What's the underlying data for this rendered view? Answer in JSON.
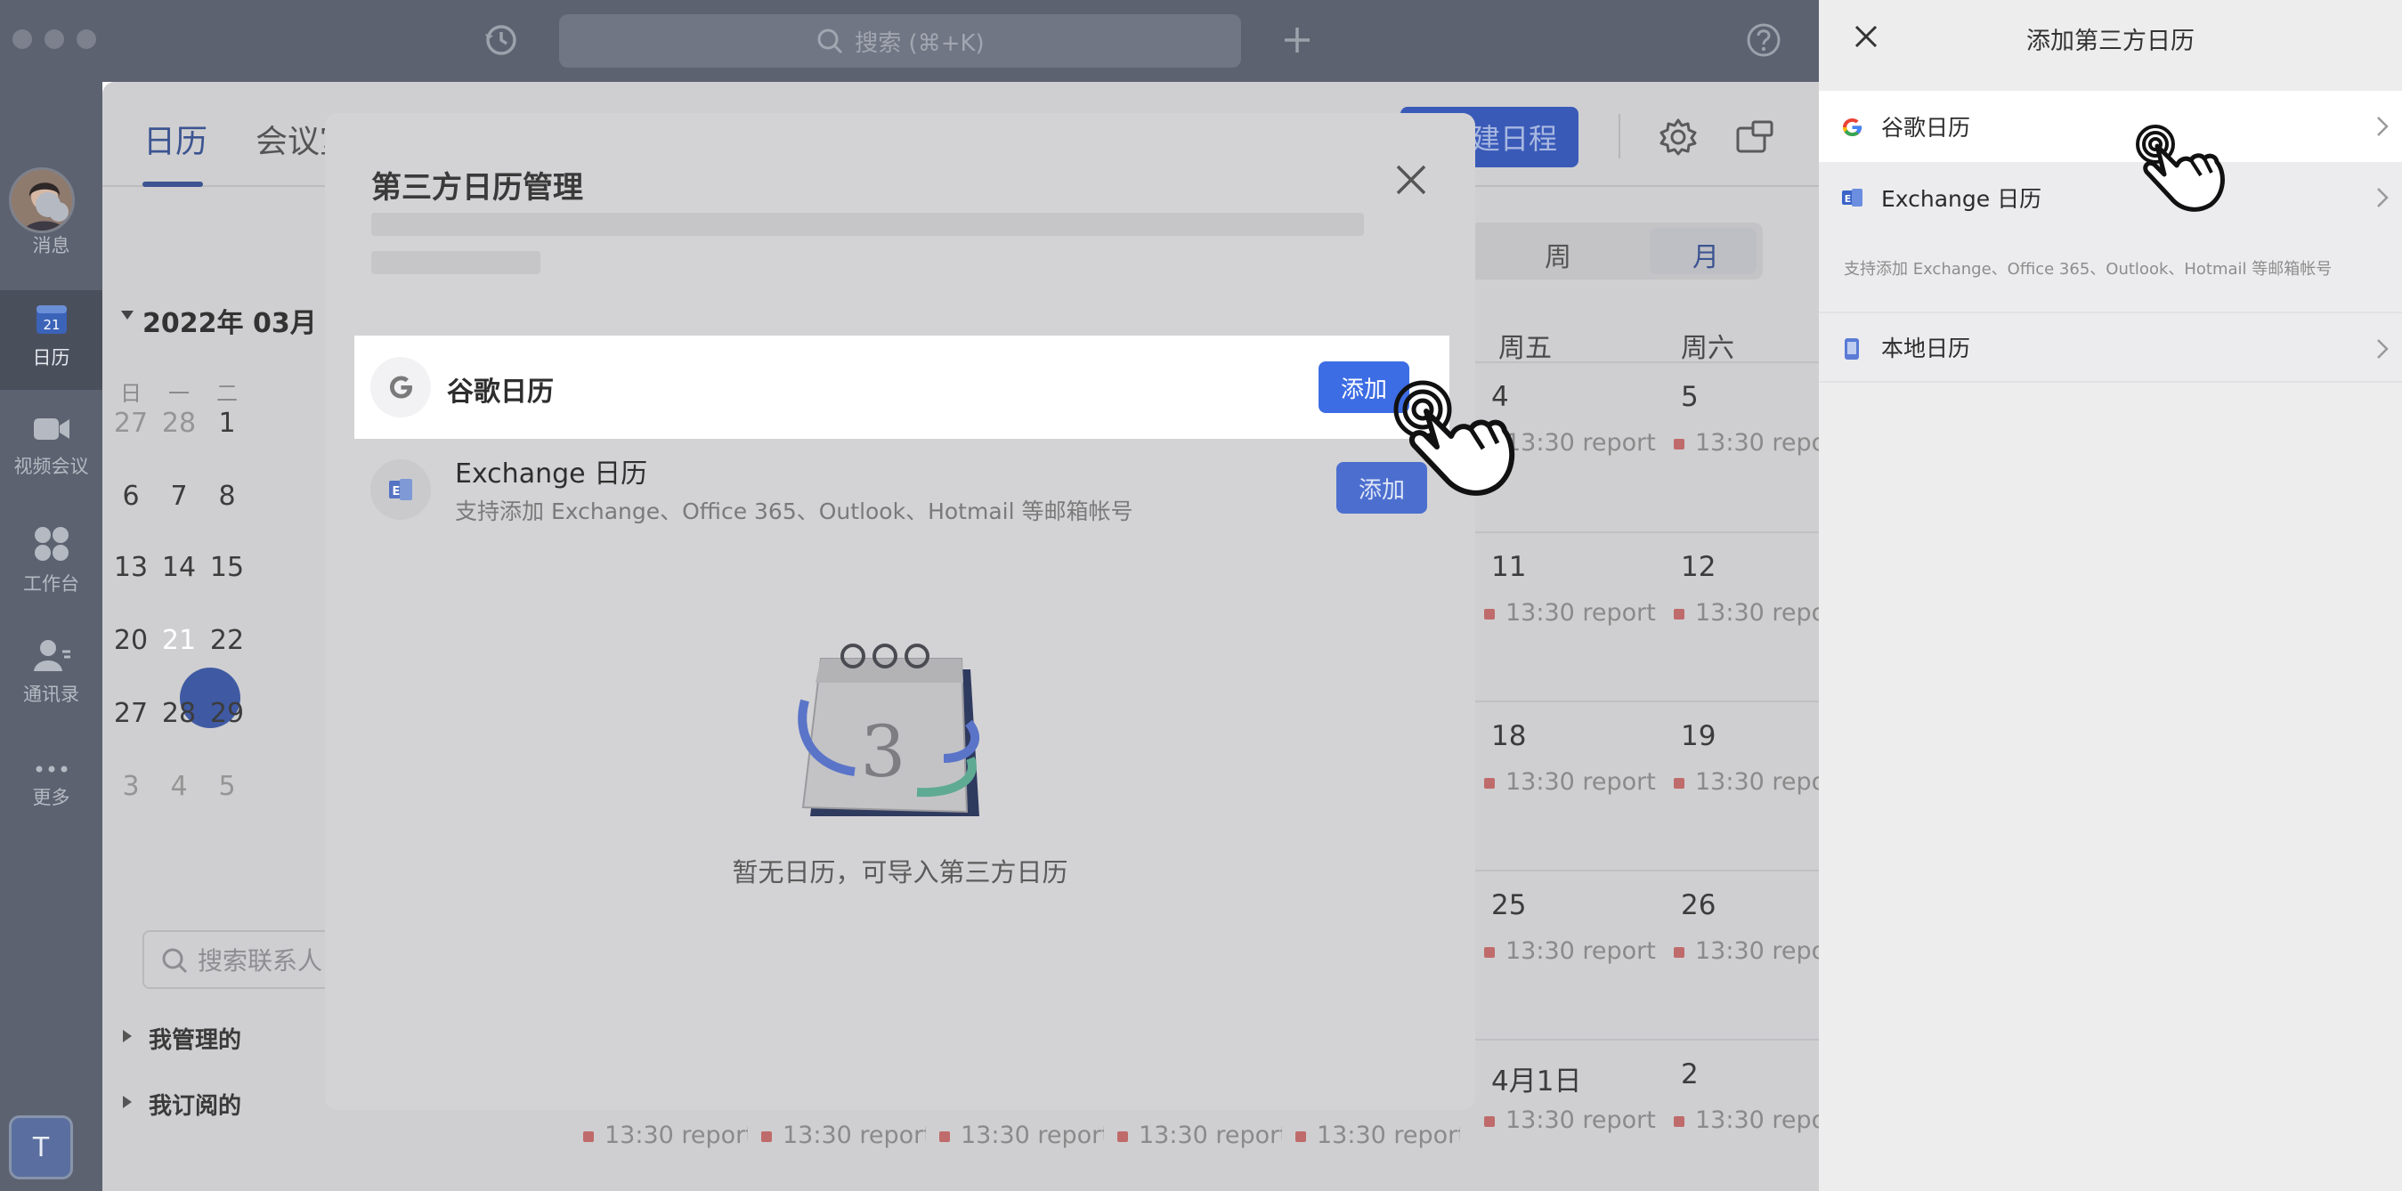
{
  "topbar": {
    "search_placeholder": "搜索 (⌘+K)"
  },
  "sidebar": {
    "items": [
      {
        "label": "消息",
        "icon": "chat-icon"
      },
      {
        "label": "日历",
        "icon": "calendar-icon",
        "badge": "21"
      },
      {
        "label": "视频会议",
        "icon": "video-icon"
      },
      {
        "label": "工作台",
        "icon": "apps-icon"
      },
      {
        "label": "通讯录",
        "icon": "contacts-icon"
      },
      {
        "label": "更多",
        "icon": "more-icon"
      }
    ],
    "user_initial": "T"
  },
  "calendar": {
    "tabs": [
      "日历",
      "会议室"
    ],
    "new_event_label": "建日程",
    "month_title": "2022年 03月",
    "weekday_heads": [
      "日",
      "一",
      "二"
    ],
    "mini_weeks": [
      [
        "27",
        "28",
        "1"
      ],
      [
        "6",
        "7",
        "8"
      ],
      [
        "13",
        "14",
        "15"
      ],
      [
        "20",
        "21",
        "22"
      ],
      [
        "27",
        "28",
        "29"
      ],
      [
        "3",
        "4",
        "5"
      ]
    ],
    "contact_search_placeholder": "搜索联系人",
    "groups": [
      "我管理的",
      "我订阅的"
    ],
    "view_options": [
      "周",
      "月"
    ],
    "grid_heads": [
      "周五",
      "周六"
    ],
    "grid_rows": [
      {
        "fri": "4",
        "sat": "5"
      },
      {
        "fri": "11",
        "sat": "12"
      },
      {
        "fri": "18",
        "sat": "19"
      },
      {
        "fri": "25",
        "sat": "26"
      },
      {
        "fri": "4月1日",
        "sat": "2"
      }
    ],
    "event_label": "13:30 report"
  },
  "modal": {
    "title": "第三方日历管理",
    "google": {
      "title": "谷歌日历",
      "button": "添加"
    },
    "exchange": {
      "title": "Exchange 日历",
      "subtitle": "支持添加 Exchange、Office 365、Outlook、Hotmail 等邮箱帐号",
      "button": "添加"
    },
    "illustration_number": "3",
    "empty_text": "暂无日历，可导入第三方日历"
  },
  "panel": {
    "title": "添加第三方日历",
    "google_label": "谷歌日历",
    "exchange_label": "Exchange 日历",
    "note": "支持添加 Exchange、Office 365、Outlook、Hotmail 等邮箱帐号",
    "local_label": "本地日历"
  },
  "colors": {
    "accent": "#3d6de4",
    "sidebar": "#5c6270",
    "event": "#c06b6b"
  }
}
